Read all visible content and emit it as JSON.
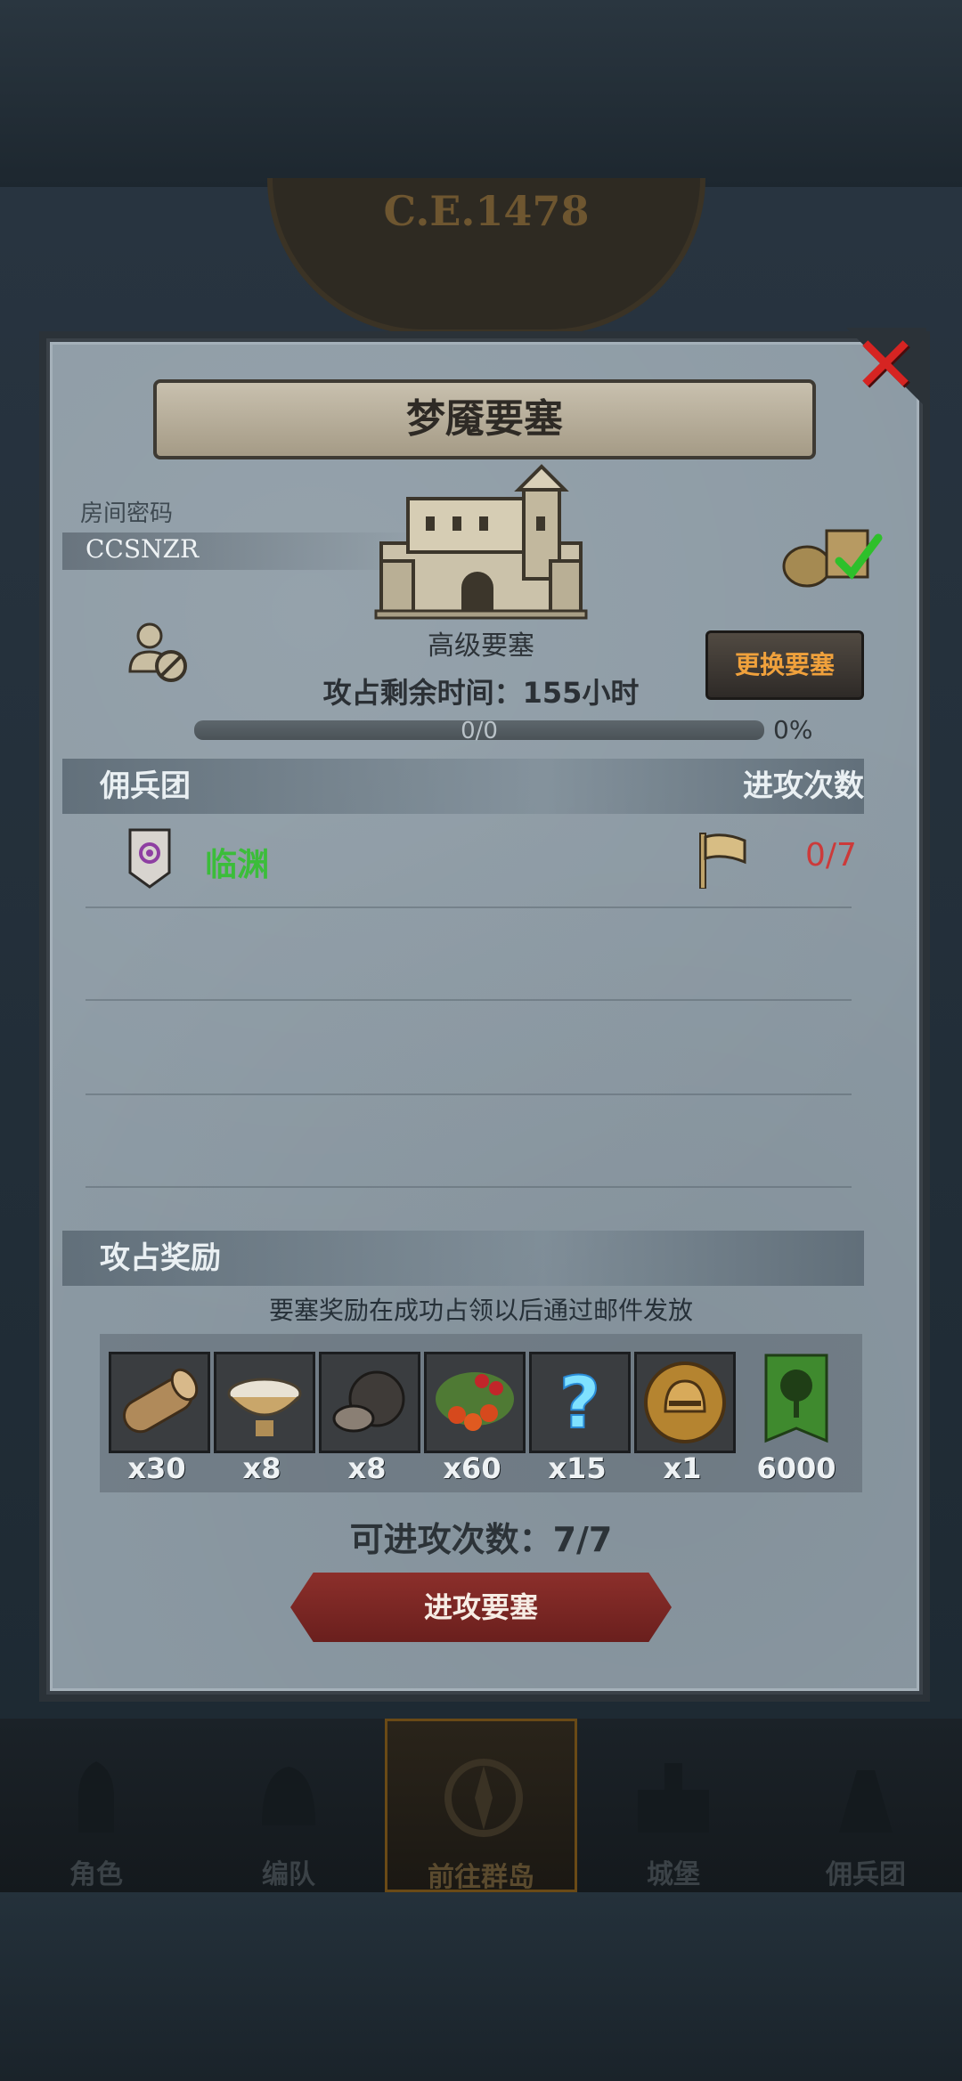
{
  "header": {
    "year": "C.E.1478"
  },
  "dialog": {
    "title": "梦魇要塞",
    "close_glyph": "✕",
    "room_password_label": "房间密码",
    "room_password_value": "CCSNZR",
    "fortress_type": "高级要塞",
    "remaining_time": "攻占剩余时间：155小时",
    "change_button": "更换要塞",
    "progress": {
      "text": "0/0",
      "percent_text": "0%",
      "fraction": 0
    },
    "members_section": {
      "left_label": "佣兵团",
      "right_label": "进攻次数",
      "members": [
        {
          "name": "临渊",
          "attacks": "0/7"
        }
      ]
    },
    "rewards_section": {
      "label": "攻占奖励",
      "note": "要塞奖励在成功占领以后通过邮件发放",
      "items": [
        {
          "icon": "log-icon",
          "count": "x30"
        },
        {
          "icon": "bowl-icon",
          "count": "x8"
        },
        {
          "icon": "truffle-icon",
          "count": "x8"
        },
        {
          "icon": "berries-icon",
          "count": "x60"
        },
        {
          "icon": "question-mark-icon",
          "count": "x15"
        },
        {
          "icon": "helmet-medal-icon",
          "count": "x1"
        },
        {
          "icon": "tree-banner-icon",
          "count": "6000"
        }
      ]
    },
    "attack_count_text": "可进攻次数：7/7",
    "attack_button": "进攻要塞"
  },
  "nav": [
    {
      "label": "角色"
    },
    {
      "label": "编队"
    },
    {
      "label": "前往群岛",
      "active": true
    },
    {
      "label": "城堡"
    },
    {
      "label": "佣兵团"
    }
  ],
  "colors": {
    "member_name": "#3bbd3a",
    "attack_count": "#cc3a3a",
    "change_button_text": "#f0a13c",
    "close": "#d62422"
  }
}
